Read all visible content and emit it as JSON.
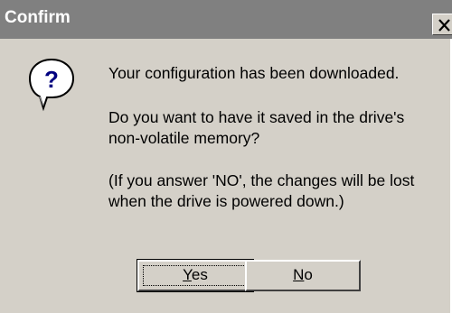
{
  "window": {
    "title": "Confirm",
    "close_icon": "close-x-icon"
  },
  "icon": {
    "name": "question-icon",
    "glyph": "?"
  },
  "message": {
    "line1": "Your configuration has been downloaded.",
    "line2": "Do you want to have it saved in the drive's",
    "line3": "non-volatile memory?",
    "line4": "(If you answer 'NO', the changes will be lost",
    "line5": "when the drive is powered down.)"
  },
  "buttons": {
    "yes": {
      "mnemonic": "Y",
      "rest": "es"
    },
    "no": {
      "mnemonic": "N",
      "rest": "o"
    }
  },
  "colors": {
    "titlebar": "#808080",
    "dialog_bg": "#d4d0c8",
    "icon_question": "#000080"
  }
}
